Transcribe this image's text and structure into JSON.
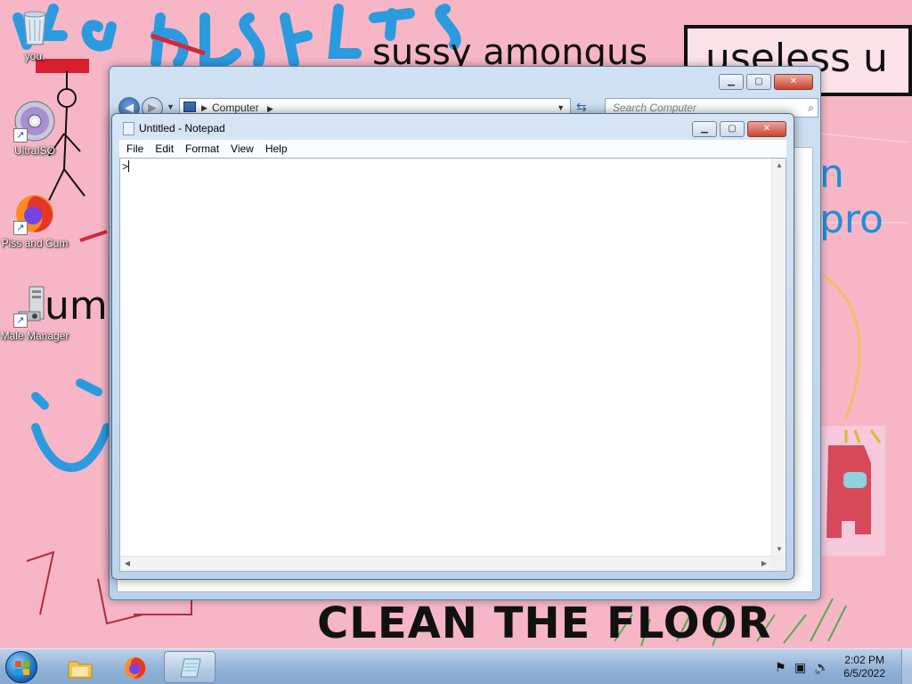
{
  "wallpaper": {
    "text_sussy": "sussy amongus",
    "text_useless_u": "useless u",
    "text_clean_floor": "CLEAN THE FLOOR",
    "text_pro": "n pro",
    "text_uml": "uml"
  },
  "desktop_icons": [
    {
      "label": "you.",
      "icon": "recycle-bin-icon"
    },
    {
      "label": "UltraISO",
      "icon": "disc-icon"
    },
    {
      "label": "Piss and Cum",
      "icon": "firefox-icon"
    },
    {
      "label": "Male Manager",
      "icon": "computer-manager-icon"
    }
  ],
  "explorer": {
    "address": "Computer",
    "search_placeholder": "Search Computer"
  },
  "notepad": {
    "title": "Untitled - Notepad",
    "menu": [
      "File",
      "Edit",
      "Format",
      "View",
      "Help"
    ],
    "content": ">"
  },
  "taskbar": {
    "items": [
      "file-explorer-icon",
      "firefox-icon",
      "notepad-icon"
    ],
    "active_item": "notepad-icon",
    "clock_time": "2:02 PM",
    "clock_date": "6/5/2022"
  },
  "colors": {
    "wallpaper_bg": "#f7b6c6",
    "wallpaper_blue": "#1e8fd8",
    "window_frame": "#bcd3ec"
  }
}
